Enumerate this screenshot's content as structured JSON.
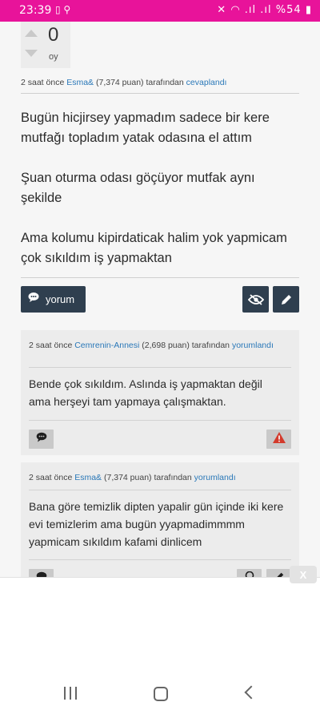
{
  "status_bar": {
    "time": "23:39",
    "battery": "%54"
  },
  "vote": {
    "count": "0",
    "label": "oy"
  },
  "answer": {
    "meta_time": "2 saat önce",
    "meta_user": "Esma&",
    "meta_points": "(7,374 puan)",
    "meta_by": "tarafından",
    "meta_action": "cevaplandı",
    "paragraphs": [
      "Bugün hicjirsey yapmadım sadece bir kere mutfağı topladım yatak odasına el attım",
      "Şuan oturma odası göçüyor mutfak aynı şekilde",
      "Ama kolumu kipirdaticak halim yok yapmicam çok sıkıldım iş yapmaktan"
    ],
    "comment_button_label": "yorum"
  },
  "comments": [
    {
      "meta_time": "2 saat önce",
      "meta_user": "Cemrenin-Annesi",
      "meta_points": "(2,698 puan)",
      "meta_by": "tarafından",
      "meta_action": "yorumlandı",
      "text": "Bende çok sıkıldım. Aslında iş yapmaktan değil ama herşeyi tam yapmaya çalışmaktan."
    },
    {
      "meta_time": "2 saat önce",
      "meta_user": "Esma&",
      "meta_points": "(7,374 puan)",
      "meta_by": "tarafından",
      "meta_action": "yorumlandı",
      "text": "Bana göre temizlik dipten yapalir gün içinde iki kere evi temizlerim ama bugün yyapmadimmmm yapmicam sıkıldım kafami dinlicem"
    }
  ],
  "ad": {
    "close_label": "X"
  },
  "colors": {
    "status_bar": "#e8139a",
    "link": "#2a78b8",
    "button_dark": "#2f3f4f",
    "comment_bg": "#ececec",
    "warning_red": "#d33a2c"
  },
  "icons": [
    "comment-icon",
    "hide-icon",
    "edit-icon",
    "flag-icon",
    "lightbulb-icon",
    "close-icon"
  ]
}
